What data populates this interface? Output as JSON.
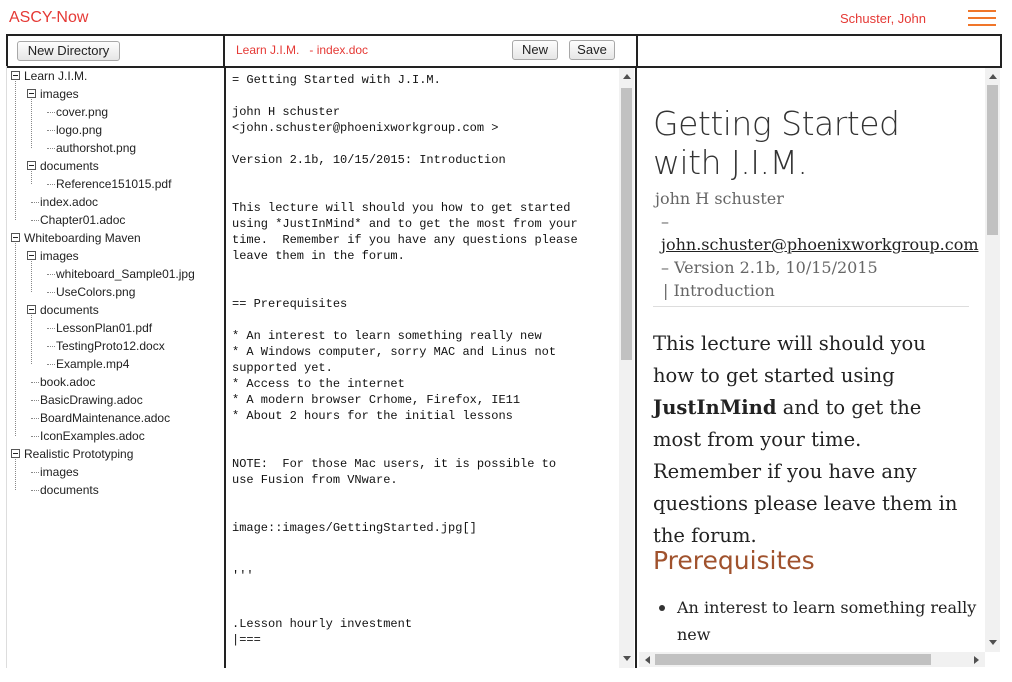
{
  "app": {
    "title": "ASCY-Now",
    "user": "Schuster, John"
  },
  "toolbar": {
    "new_directory_label": "New Directory",
    "doc_title": "Learn J.I.M.   - index.doc",
    "new_label": "New",
    "save_label": "Save"
  },
  "tree": [
    {
      "label": "Learn J.I.M.",
      "kind": "folder",
      "depth": 0
    },
    {
      "label": "images",
      "kind": "folder",
      "depth": 1
    },
    {
      "label": "cover.png",
      "kind": "file",
      "depth": 2
    },
    {
      "label": "logo.png",
      "kind": "file",
      "depth": 2
    },
    {
      "label": "authorshot.png",
      "kind": "file",
      "depth": 2
    },
    {
      "label": "documents",
      "kind": "folder",
      "depth": 1
    },
    {
      "label": "Reference151015.pdf",
      "kind": "file",
      "depth": 2
    },
    {
      "label": "index.adoc",
      "kind": "file",
      "depth": 1
    },
    {
      "label": "Chapter01.adoc",
      "kind": "file",
      "depth": 1
    },
    {
      "label": "Whiteboarding Maven",
      "kind": "folder",
      "depth": 0
    },
    {
      "label": "images",
      "kind": "folder",
      "depth": 1
    },
    {
      "label": "whiteboard_Sample01.jpg",
      "kind": "file",
      "depth": 2
    },
    {
      "label": "UseColors.png",
      "kind": "file",
      "depth": 2
    },
    {
      "label": "documents",
      "kind": "folder",
      "depth": 1
    },
    {
      "label": "LessonPlan01.pdf",
      "kind": "file",
      "depth": 2
    },
    {
      "label": "TestingProto12.docx",
      "kind": "file",
      "depth": 2
    },
    {
      "label": "Example.mp4",
      "kind": "file",
      "depth": 2
    },
    {
      "label": "book.adoc",
      "kind": "file",
      "depth": 1
    },
    {
      "label": "BasicDrawing.adoc",
      "kind": "file",
      "depth": 1
    },
    {
      "label": "BoardMaintenance.adoc",
      "kind": "file",
      "depth": 1
    },
    {
      "label": "IconExamples.adoc",
      "kind": "file",
      "depth": 1
    },
    {
      "label": "Realistic Prototyping",
      "kind": "folder",
      "depth": 0
    },
    {
      "label": "images",
      "kind": "file",
      "depth": 1
    },
    {
      "label": "documents",
      "kind": "file",
      "depth": 1
    }
  ],
  "editor": {
    "lines": [
      "= Getting Started with J.I.M.",
      "",
      "john H schuster",
      "<john.schuster@phoenixworkgroup.com >",
      "",
      "Version 2.1b, 10/15/2015: Introduction",
      "",
      "",
      "This lecture will should you how to get started",
      "using *JustInMind* and to get the most from your",
      "time.  Remember if you have any questions please",
      "leave them in the forum.",
      "",
      "",
      "== Prerequisites",
      "",
      "* An interest to learn something really new",
      "* A Windows computer, sorry MAC and Linus not",
      "supported yet.",
      "* Access to the internet",
      "* A modern browser Crhome, Firefox, IE11",
      "* About 2 hours for the initial lessons",
      "",
      "",
      "NOTE:  For those Mac users, it is possible to",
      "use Fusion from VNware.",
      "",
      "",
      "image::images/GettingStarted.jpg[]",
      "",
      "",
      "'''",
      "",
      "",
      ".Lesson hourly investment",
      "|==="
    ]
  },
  "preview": {
    "title": "Getting Started with J.I.M.",
    "author": "john H schuster",
    "dash": "–",
    "email": "john.schuster@phoenixworkgroup.com",
    "version": "– Version 2.1b, 10/15/2015",
    "remark": "| Introduction",
    "para_before": "This lecture will should you how to get started using ",
    "para_bold": "JustInMind",
    "para_after": " and to get the most from your time. Remember if you have any questions please leave them in the forum.",
    "section": "Prerequisites",
    "list": [
      "An interest to learn something really new"
    ]
  },
  "colors": {
    "brand": "#e53935",
    "menu": "#f0762a",
    "section": "#a0522d"
  },
  "icons": {
    "menu": "hamburger-menu-icon",
    "tree_toggle": "minus-box-icon"
  }
}
